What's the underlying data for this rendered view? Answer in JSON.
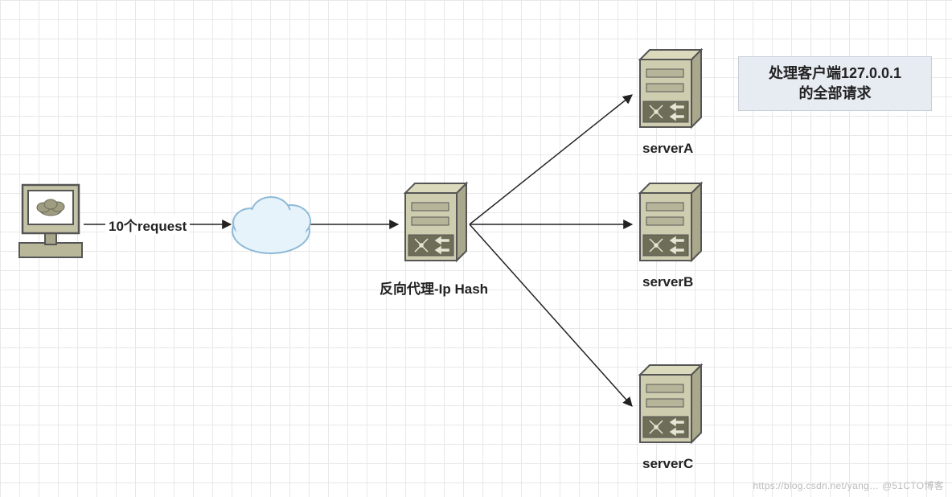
{
  "client": {
    "label": "10个request"
  },
  "proxy": {
    "label": "反向代理-Ip Hash"
  },
  "serverA": {
    "label": "serverA"
  },
  "serverB": {
    "label": "serverB"
  },
  "serverC": {
    "label": "serverC"
  },
  "callout": {
    "line1": "处理客户端127.0.0.1",
    "line2": "的全部请求"
  },
  "watermark": "https://blog.csdn.net/yang…  @51CTO博客"
}
